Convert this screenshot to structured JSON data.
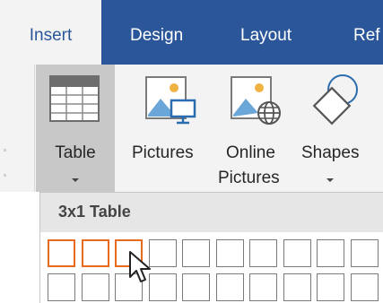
{
  "tabs": [
    {
      "label": "Insert",
      "active": true
    },
    {
      "label": "Design",
      "active": false
    },
    {
      "label": "Layout",
      "active": false
    },
    {
      "label": "Ref",
      "active": false
    }
  ],
  "ribbon": {
    "table_label": "Table",
    "pictures_label": "Pictures",
    "online_pictures_line1": "Online",
    "online_pictures_line2": "Pictures",
    "shapes_label": "Shapes"
  },
  "table_dropdown": {
    "title": "3x1 Table",
    "selected_columns": 3,
    "selected_rows": 1
  },
  "colors": {
    "ribbon_blue": "#2b579a",
    "selection_orange": "#e86a1f"
  }
}
